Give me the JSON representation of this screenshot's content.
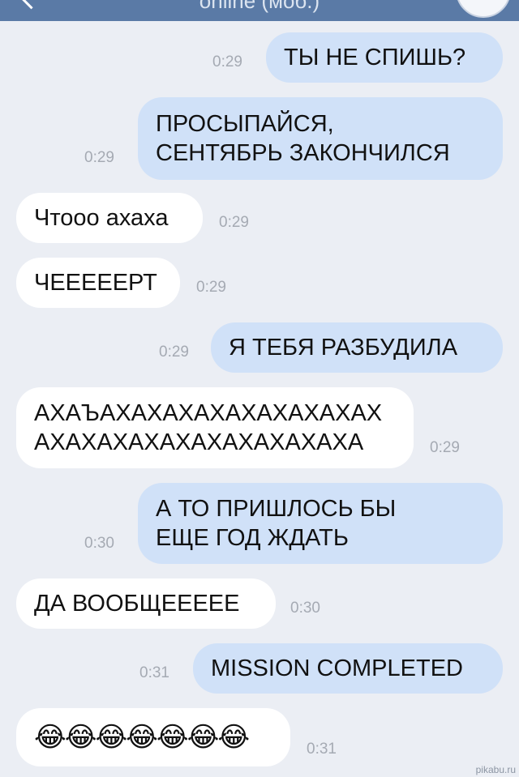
{
  "header": {
    "status": "online (моб.)"
  },
  "messages": [
    {
      "dir": "out",
      "text": "ТЫ НЕ СПИШЬ?",
      "time": "0:29"
    },
    {
      "dir": "out",
      "text": "ПРОСЫПАЙСЯ,\nСЕНТЯБРЬ ЗАКОНЧИЛСЯ",
      "time": "0:29"
    },
    {
      "dir": "in",
      "text": "Чтооо ахаха",
      "time": "0:29"
    },
    {
      "dir": "in",
      "text": "ЧЕЕЕЕЕРТ",
      "time": "0:29"
    },
    {
      "dir": "out",
      "text": "Я ТЕБЯ РАЗБУДИЛА",
      "time": "0:29"
    },
    {
      "dir": "in",
      "text": "АХАЪАХАХАХАХАХАХАХАХАХ\nАХАХАХАХАХАХАХАХАХАХА",
      "time": "0:29"
    },
    {
      "dir": "out",
      "text": "А ТО ПРИШЛОСЬ БЫ\nЕЩЕ ГОД ЖДАТЬ",
      "time": "0:30"
    },
    {
      "dir": "in",
      "text": "ДА ВООБЩЕЕЕЕЕ",
      "time": "0:30"
    },
    {
      "dir": "out",
      "text": "MISSION COMPLETED",
      "time": "0:31"
    },
    {
      "dir": "in",
      "text": "😂😂😂😂😂😂😂",
      "time": "0:31"
    }
  ],
  "watermark": "pikabu.ru"
}
